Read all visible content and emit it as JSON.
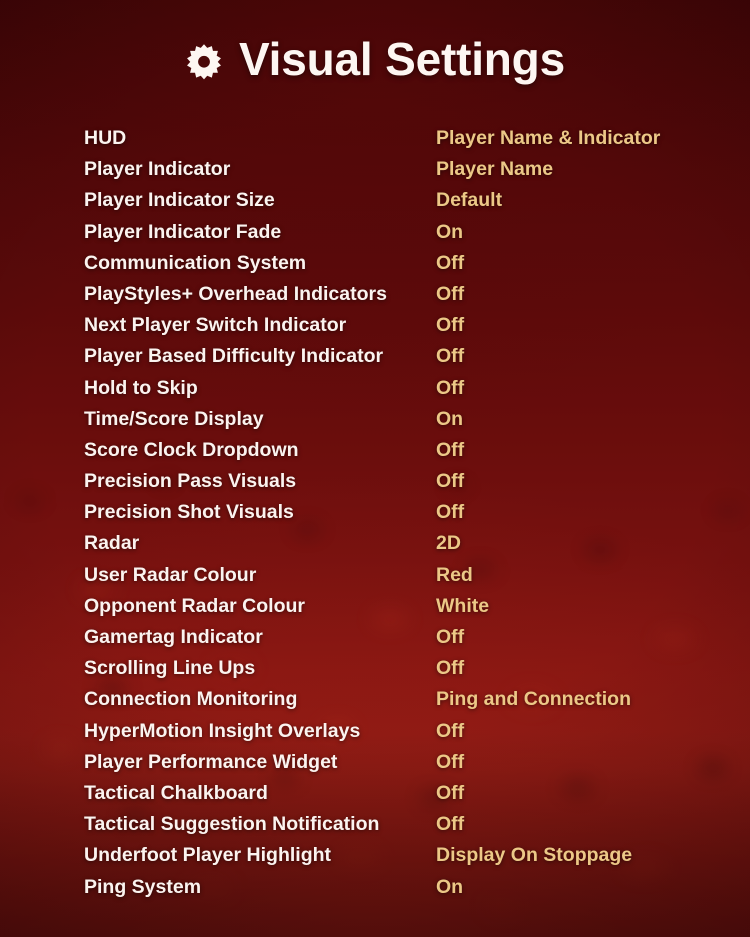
{
  "header": {
    "icon": "gear-icon",
    "title": "Visual Settings"
  },
  "colors": {
    "label_text": "#FBF3EF",
    "value_text": "#ECC887",
    "background_top": "#3D0506",
    "background_bottom": "#8D1A14"
  },
  "settings": [
    {
      "label": "HUD",
      "value": "Player Name & Indicator"
    },
    {
      "label": "Player Indicator",
      "value": "Player Name"
    },
    {
      "label": "Player Indicator Size",
      "value": "Default"
    },
    {
      "label": "Player Indicator Fade",
      "value": "On"
    },
    {
      "label": "Communication System",
      "value": "Off"
    },
    {
      "label": "PlayStyles+ Overhead Indicators",
      "value": "Off"
    },
    {
      "label": "Next Player Switch Indicator",
      "value": "Off"
    },
    {
      "label": "Player Based Difficulty Indicator",
      "value": "Off"
    },
    {
      "label": "Hold to Skip",
      "value": "Off"
    },
    {
      "label": "Time/Score Display",
      "value": "On"
    },
    {
      "label": "Score Clock Dropdown",
      "value": "Off"
    },
    {
      "label": "Precision Pass Visuals",
      "value": "Off"
    },
    {
      "label": "Precision Shot Visuals",
      "value": "Off"
    },
    {
      "label": "Radar",
      "value": "2D"
    },
    {
      "label": "User Radar Colour",
      "value": "Red"
    },
    {
      "label": "Opponent Radar Colour",
      "value": "White"
    },
    {
      "label": "Gamertag Indicator",
      "value": "Off"
    },
    {
      "label": "Scrolling Line Ups",
      "value": "Off"
    },
    {
      "label": "Connection Monitoring",
      "value": "Ping and Connection"
    },
    {
      "label": "HyperMotion Insight Overlays",
      "value": "Off"
    },
    {
      "label": "Player Performance Widget",
      "value": "Off"
    },
    {
      "label": "Tactical Chalkboard",
      "value": "Off"
    },
    {
      "label": "Tactical Suggestion Notification",
      "value": "Off"
    },
    {
      "label": "Underfoot Player Highlight",
      "value": "Display On Stoppage"
    },
    {
      "label": "Ping System",
      "value": "On"
    }
  ]
}
